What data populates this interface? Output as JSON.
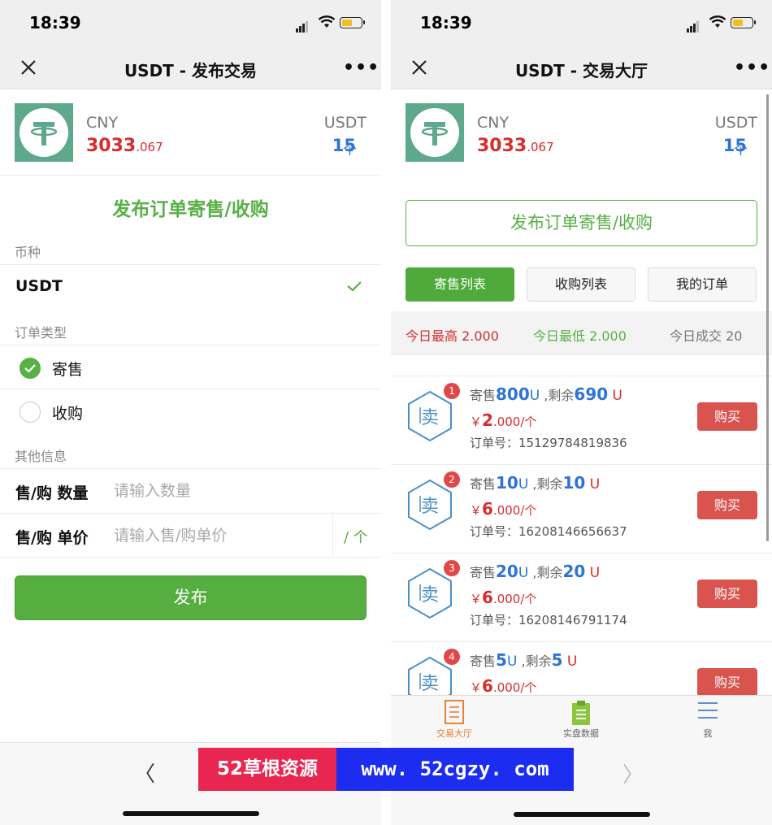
{
  "status": {
    "time": "18:39"
  },
  "left": {
    "nav_title": "USDT - 发布交易",
    "more": "•••",
    "coin": {
      "cny_label": "CNY",
      "cny_int": "3033",
      "cny_dec": ".067",
      "usdt_label": "USDT",
      "usdt_val": "15",
      "usdt_unit": "个"
    },
    "form_title": "发布订单寄售/收购",
    "sec_currency": "币种",
    "currency": "USDT",
    "sec_order_type": "订单类型",
    "opt_sell": "寄售",
    "opt_buy": "收购",
    "sec_other": "其他信息",
    "qty_label": "售/购 数量",
    "qty_placeholder": "请输入数量",
    "price_label": "售/购 单价",
    "price_placeholder": "请输入售/购单价",
    "price_unit": "/ 个",
    "publish": "发布",
    "back": "〈",
    "forward": "〉"
  },
  "right": {
    "nav_title": "USDT - 交易大厅",
    "more": "•••",
    "coin": {
      "cny_label": "CNY",
      "cny_int": "3033",
      "cny_dec": ".067",
      "usdt_label": "USDT",
      "usdt_val": "15",
      "usdt_unit": "个"
    },
    "publish_btn": "发布订单寄售/收购",
    "tabs": [
      "寄售列表",
      "收购列表",
      "我的订单"
    ],
    "stats": {
      "high": "今日最高 2.000",
      "low": "今日最低 2.000",
      "deals": "今日成交 20"
    },
    "items": [
      {
        "badge": "1",
        "icon": "卖",
        "sell_pre": "寄售",
        "sell_q": "800",
        "sell_u": "U",
        "rem_pre": " ,剩余",
        "rem_q": "690",
        "rem_u": " U",
        "yen": "￥",
        "price_int": "2",
        "price_rest": ".000/个",
        "order_label": "订单号：",
        "order_no": "15129784819836",
        "buy": "购买"
      },
      {
        "badge": "2",
        "icon": "卖",
        "sell_pre": "寄售",
        "sell_q": "10",
        "sell_u": "U",
        "rem_pre": " ,剩余",
        "rem_q": "10",
        "rem_u": " U",
        "yen": "￥",
        "price_int": "6",
        "price_rest": ".000/个",
        "order_label": "订单号：",
        "order_no": "16208146656637",
        "buy": "购买"
      },
      {
        "badge": "3",
        "icon": "卖",
        "sell_pre": "寄售",
        "sell_q": "20",
        "sell_u": "U",
        "rem_pre": " ,剩余",
        "rem_q": "20",
        "rem_u": " U",
        "yen": "￥",
        "price_int": "6",
        "price_rest": ".000/个",
        "order_label": "订单号：",
        "order_no": "16208146791174",
        "buy": "购买"
      },
      {
        "badge": "4",
        "icon": "卖",
        "sell_pre": "寄售",
        "sell_q": "5",
        "sell_u": "U",
        "rem_pre": " ,剩余",
        "rem_q": "5",
        "rem_u": " U",
        "yen": "￥",
        "price_int": "6",
        "price_rest": ".000/个",
        "order_label": "",
        "order_no": "",
        "buy": "购买"
      }
    ],
    "tabbar": [
      "交易大厅",
      "实盘数据",
      "我"
    ]
  },
  "watermark": {
    "left": "52草根资源",
    "right": "www. 52cgzy. com"
  },
  "colors": {
    "green": "#58b046",
    "red": "#d62d2d",
    "blue": "#2d74d6",
    "buy_red": "#d9534f",
    "logo": "#5ea88c"
  }
}
